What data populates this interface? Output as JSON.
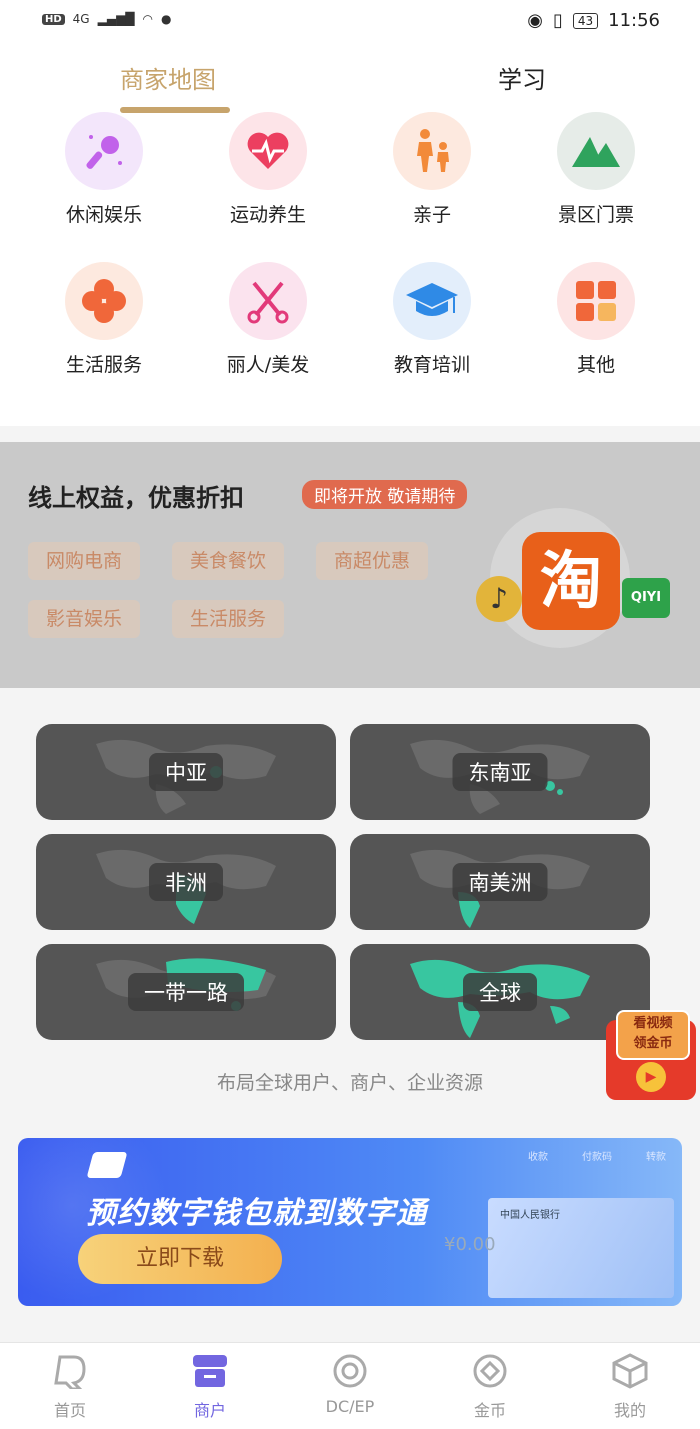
{
  "status_bar": {
    "hd": "HD",
    "network": "4G",
    "time": "11:56",
    "battery": "43"
  },
  "tabs": [
    {
      "label": "商家地图",
      "active": true
    },
    {
      "label": "学习",
      "active": false
    }
  ],
  "categories": [
    {
      "label": "休闲娱乐",
      "icon": "microphone-icon"
    },
    {
      "label": "运动养生",
      "icon": "heartbeat-icon"
    },
    {
      "label": "亲子",
      "icon": "parent-child-icon"
    },
    {
      "label": "景区门票",
      "icon": "mountain-icon"
    },
    {
      "label": "生活服务",
      "icon": "flower-icon"
    },
    {
      "label": "丽人/美发",
      "icon": "scissors-icon"
    },
    {
      "label": "教育培训",
      "icon": "graduation-cap-icon"
    },
    {
      "label": "其他",
      "icon": "grid-icon"
    }
  ],
  "promo": {
    "title": "线上权益，优惠折扣",
    "badge": "即将开放 敬请期待",
    "tags": [
      "网购电商",
      "美食餐饮",
      "商超优惠",
      "影音娱乐",
      "生活服务"
    ],
    "logo_text": "淘",
    "logo_text_2": "QIYI"
  },
  "regions": {
    "items": [
      "中亚",
      "东南亚",
      "非洲",
      "南美洲",
      "一带一路",
      "全球"
    ],
    "caption": "布局全球用户、商户、企业资源"
  },
  "reward": {
    "line1": "看视频",
    "line2": "领金币"
  },
  "banner": {
    "title": "预约数字钱包就到数字通",
    "button": "立即下载",
    "phone_labels": [
      "收款",
      "付款码",
      "转款"
    ],
    "bank_name": "中国人民银行",
    "amount": "¥0.00"
  },
  "bottom_nav": [
    {
      "label": "首页",
      "active": false
    },
    {
      "label": "商户",
      "active": true
    },
    {
      "label": "DC/EP",
      "active": false
    },
    {
      "label": "金币",
      "active": false
    },
    {
      "label": "我的",
      "active": false
    }
  ],
  "colors": {
    "accent_gold": "#c7a46c",
    "nav_active": "#7266e0",
    "region_bg": "#555555",
    "promo_bg": "#c9c9c9"
  }
}
